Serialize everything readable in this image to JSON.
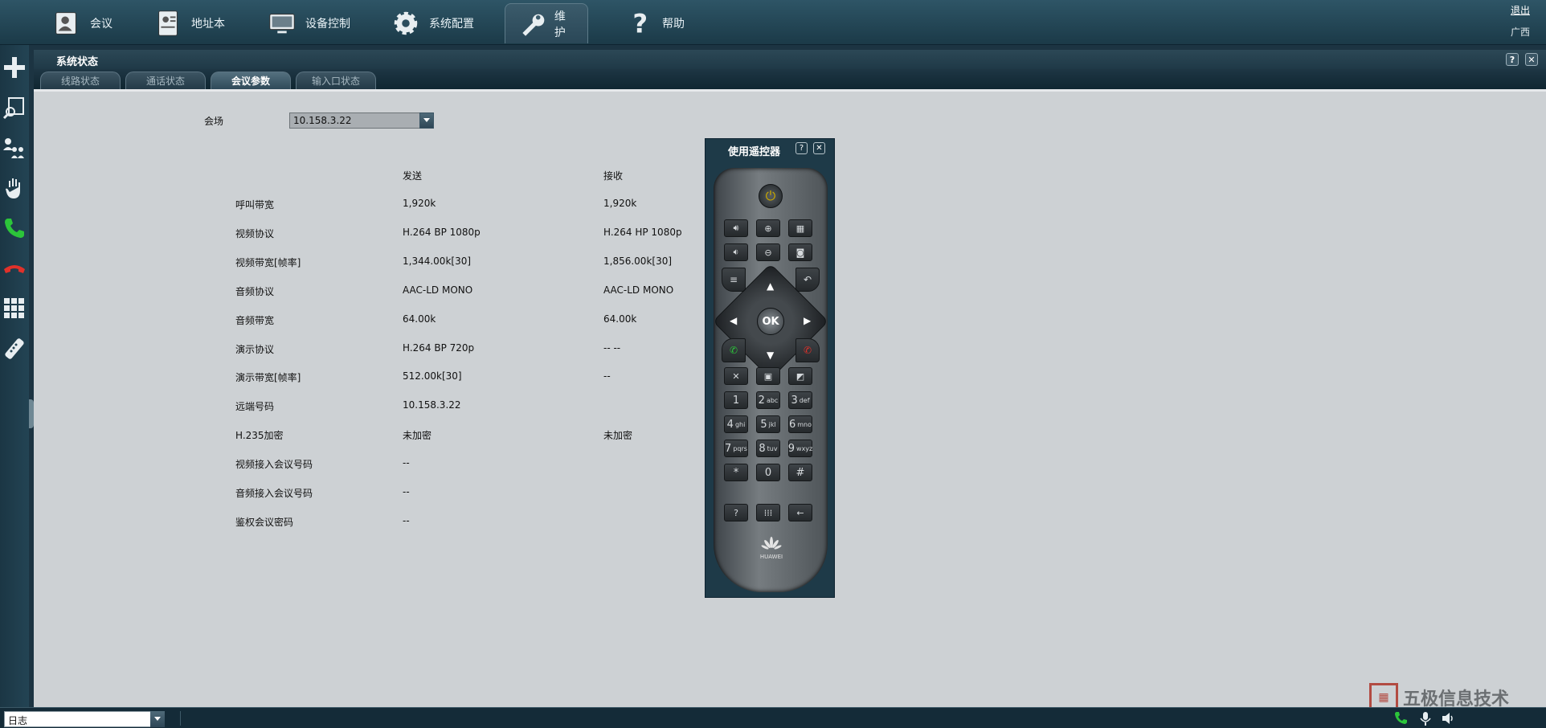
{
  "topnav": {
    "items": [
      {
        "label": "会议",
        "icon": "meeting-icon"
      },
      {
        "label": "地址本",
        "icon": "addressbook-icon"
      },
      {
        "label": "设备控制",
        "icon": "monitor-icon"
      },
      {
        "label": "系统配置",
        "icon": "gear-icon"
      },
      {
        "label": "维护",
        "icon": "wrench-icon",
        "active": true
      },
      {
        "label": "帮助",
        "icon": "help-icon"
      }
    ],
    "logout": "退出",
    "region": "广西"
  },
  "panel": {
    "title": "系统状态",
    "tabs": [
      {
        "label": "线路状态"
      },
      {
        "label": "通话状态"
      },
      {
        "label": "会议参数",
        "active": true
      },
      {
        "label": "输入口状态"
      }
    ]
  },
  "site": {
    "label": "会场",
    "selected": "10.158.3.22"
  },
  "params": {
    "send_header": "发送",
    "recv_header": "接收",
    "rows": [
      {
        "name": "呼叫带宽",
        "send": "1,920k",
        "recv": "1,920k"
      },
      {
        "name": "视频协议",
        "send": "H.264 BP 1080p",
        "recv": "H.264 HP 1080p"
      },
      {
        "name": "视频带宽[帧率]",
        "send": "1,344.00k[30]",
        "recv": "1,856.00k[30]"
      },
      {
        "name": "音频协议",
        "send": "AAC-LD MONO",
        "recv": "AAC-LD MONO"
      },
      {
        "name": "音频带宽",
        "send": "64.00k",
        "recv": "64.00k"
      },
      {
        "name": "演示协议",
        "send": "H.264 BP 720p",
        "recv": "-- --"
      },
      {
        "name": "演示带宽[帧率]",
        "send": "512.00k[30]",
        "recv": "--"
      },
      {
        "name": "远端号码",
        "send": "10.158.3.22",
        "recv": ""
      },
      {
        "name": "H.235加密",
        "send": "未加密",
        "recv": "未加密"
      },
      {
        "name": "视频接入会议号码",
        "send": "--",
        "recv": ""
      },
      {
        "name": "音频接入会议号码",
        "send": "--",
        "recv": ""
      },
      {
        "name": "鉴权会议密码",
        "send": "--",
        "recv": ""
      }
    ]
  },
  "remote": {
    "title": "使用遥控器",
    "ok": "OK",
    "brand": "HUAWEI",
    "numpad": [
      {
        "n": "1",
        "s": ""
      },
      {
        "n": "2",
        "s": "abc"
      },
      {
        "n": "3",
        "s": "def"
      },
      {
        "n": "4",
        "s": "ghi"
      },
      {
        "n": "5",
        "s": "jkl"
      },
      {
        "n": "6",
        "s": "mno"
      },
      {
        "n": "7",
        "s": "pqrs"
      },
      {
        "n": "8",
        "s": "tuv"
      },
      {
        "n": "9",
        "s": "wxyz"
      },
      {
        "n": "*",
        "s": ""
      },
      {
        "n": "0",
        "s": ""
      },
      {
        "n": "#",
        "s": ""
      }
    ]
  },
  "bottombar": {
    "log_selected": "日志"
  },
  "watermark": {
    "text": "五极信息技术"
  }
}
